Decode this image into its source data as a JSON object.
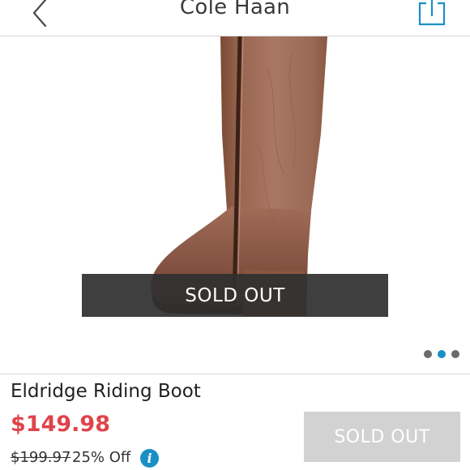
{
  "header": {
    "brand": "Cole Haan",
    "back_icon": "chevron-left-icon",
    "share_icon": "share-icon"
  },
  "hero": {
    "image_subject": "brown leather riding boot",
    "banner": "SOLD OUT",
    "carousel": {
      "total": 3,
      "active_index": 1
    }
  },
  "product": {
    "name": "Eldridge Riding Boot",
    "price": "$149.98",
    "original_price": "$199.97",
    "discount": "25% Off",
    "cta_label": "SOLD OUT"
  },
  "colors": {
    "accent": "#1a8fc4",
    "price_red": "#e0434b",
    "disabled_button": "#d2d2d2",
    "banner": "#303030"
  }
}
